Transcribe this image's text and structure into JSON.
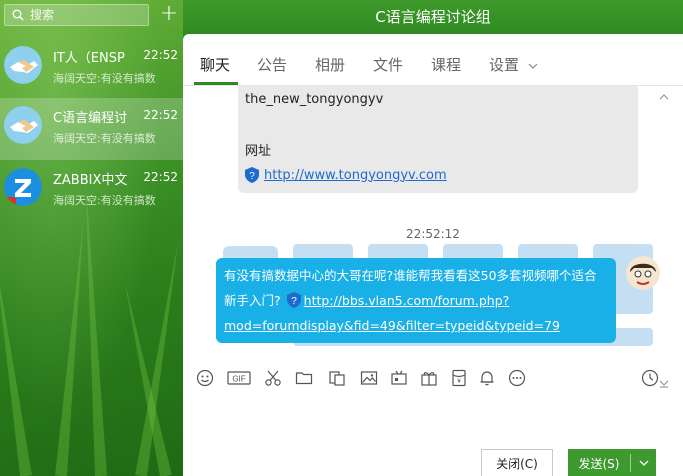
{
  "window": {
    "title": "C语言编程讨论组"
  },
  "search": {
    "placeholder": "搜索",
    "add_label": "+"
  },
  "conversations": [
    {
      "name": "IT人（ENSP",
      "time": "22:52",
      "preview": "海阔天空:有没有搞数"
    },
    {
      "name": "C语言编程讨",
      "time": "22:52",
      "preview": "海阔天空:有没有搞数"
    },
    {
      "name": "ZABBIX中文",
      "time": "22:52",
      "preview": "海阔天空:有没有搞数"
    }
  ],
  "tabs": [
    {
      "label": "聊天",
      "active": true
    },
    {
      "label": "公告"
    },
    {
      "label": "相册"
    },
    {
      "label": "文件"
    },
    {
      "label": "课程"
    },
    {
      "label": "设置"
    }
  ],
  "messages": {
    "prev_message": {
      "line1": "the_new_tongyongyv",
      "line2": "网址",
      "link": "http://www.tongyongyv.com"
    },
    "timestamp": "22:52:12",
    "current_message": {
      "text": "有没有搞数据中心的大哥在呢?谁能帮我看看这50多套视频哪个适合新手入门?",
      "link": "http://bbs.vlan5.com/forum.php?mod=forumdisplay&fid=49&filter=typeid&typeid=79"
    }
  },
  "toolbar": {
    "icons": [
      "smiley-icon",
      "gif-icon",
      "scissors-icon",
      "folder-icon",
      "screenshot-icon",
      "image-icon",
      "video-icon",
      "gift-icon",
      "red-packet-icon",
      "bell-icon",
      "more-icon",
      "history-icon"
    ],
    "gif_label": "GIF"
  },
  "buttons": {
    "close": "关闭(C)",
    "send": "发送(S)"
  },
  "colors": {
    "accent_green": "#3e9a2e",
    "bubble_blue": "#19b0e8",
    "link_blue": "#1e6bd0"
  }
}
